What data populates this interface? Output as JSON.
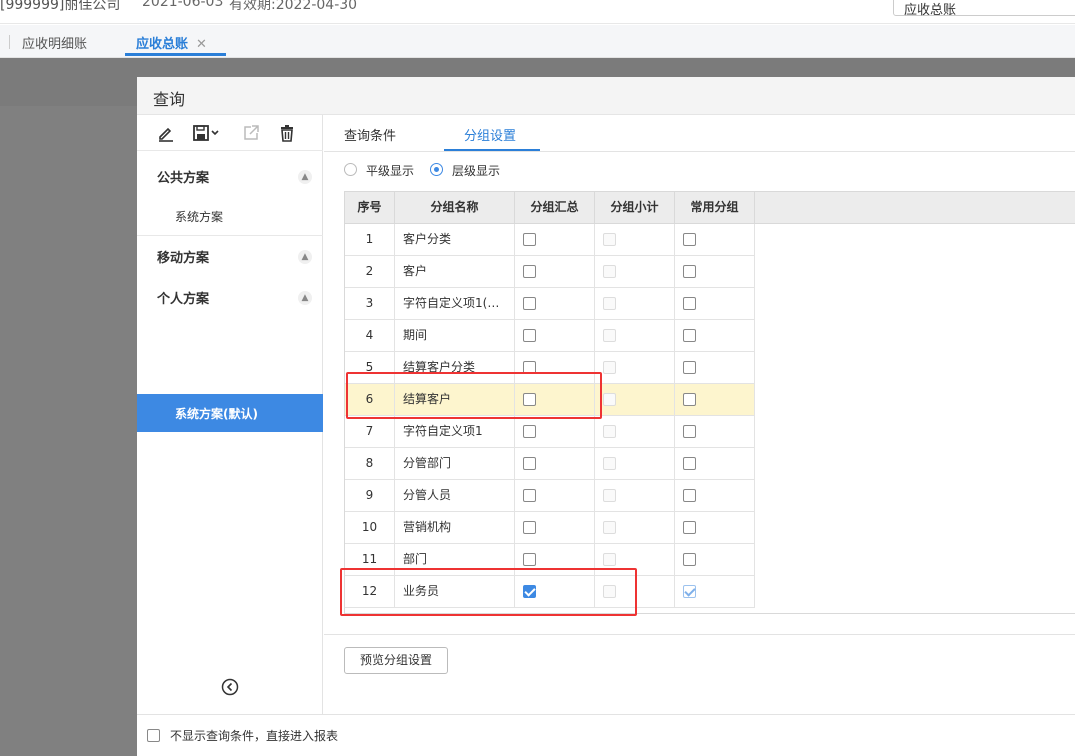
{
  "topbar": {
    "company": "[999999]丽佳公司",
    "date": "2021-06-03",
    "expiry": "有效期:2022-04-30",
    "search_value": "应收总账"
  },
  "tabs": [
    {
      "label": "应收明细账"
    },
    {
      "label": "应收总账",
      "close": "✕"
    }
  ],
  "dialog": {
    "title": "查询",
    "sections": {
      "public": {
        "title": "公共方案",
        "items": [
          "系统方案"
        ]
      },
      "mobile": {
        "title": "移动方案"
      },
      "personal": {
        "title": "个人方案",
        "items": [
          "系统方案(默认)"
        ]
      }
    },
    "right_tabs": [
      "查询条件",
      "分组设置"
    ],
    "display_modes": [
      "平级显示",
      "层级显示"
    ],
    "selected_mode": "层级显示",
    "columns": [
      "序号",
      "分组名称",
      "分组汇总",
      "分组小计",
      "常用分组"
    ],
    "rows": [
      {
        "idx": "1",
        "name": "客户分类",
        "sum": false,
        "common": false
      },
      {
        "idx": "2",
        "name": "客户",
        "sum": false,
        "common": false
      },
      {
        "idx": "3",
        "name": "字符自定义项1(…",
        "sum": false,
        "common": false
      },
      {
        "idx": "4",
        "name": "期间",
        "sum": false,
        "common": false
      },
      {
        "idx": "5",
        "name": "结算客户分类",
        "sum": false,
        "common": false
      },
      {
        "idx": "6",
        "name": "结算客户",
        "sum": false,
        "common": false
      },
      {
        "idx": "7",
        "name": "字符自定义项1",
        "sum": false,
        "common": false
      },
      {
        "idx": "8",
        "name": "分管部门",
        "sum": false,
        "common": false
      },
      {
        "idx": "9",
        "name": "分管人员",
        "sum": false,
        "common": false
      },
      {
        "idx": "10",
        "name": "营销机构",
        "sum": false,
        "common": false
      },
      {
        "idx": "11",
        "name": "部门",
        "sum": false,
        "common": false
      },
      {
        "idx": "12",
        "name": "业务员",
        "sum": true,
        "common": true
      }
    ],
    "preview_button": "预览分组设置",
    "footer_label": "不显示查询条件，直接进入报表"
  },
  "colors": {
    "accent": "#2b7fd8",
    "selected_bg": "#3d89e3",
    "highlight_row": "#fdf5ce",
    "annotation_red": "#e33333"
  }
}
